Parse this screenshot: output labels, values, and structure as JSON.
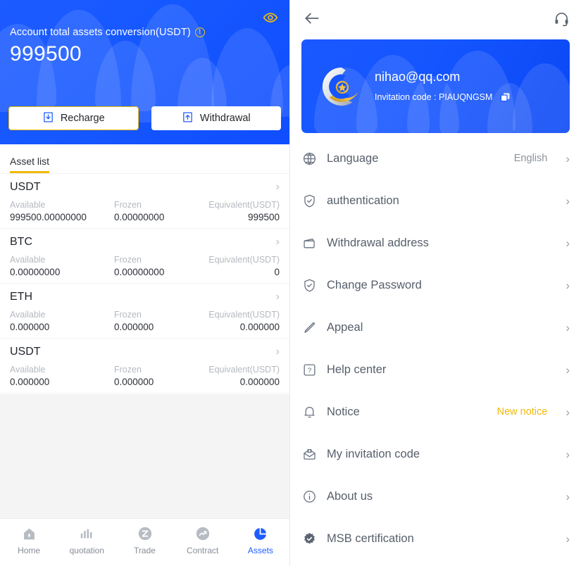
{
  "left": {
    "hero": {
      "eye_icon": "eye-icon",
      "label": "Account total assets conversion(USDT)",
      "info_icon": "info-icon",
      "amount": "999500",
      "recharge_label": "Recharge",
      "recharge_icon": "download-box-icon",
      "withdrawal_label": "Withdrawal",
      "withdrawal_icon": "upload-box-icon",
      "accent_border": "#f0b90b",
      "bg_color": "#1658ff"
    },
    "tabs": [
      {
        "label": "Asset list",
        "active": true
      }
    ],
    "columns": {
      "available": "Available",
      "frozen": "Frozen",
      "equivalent": "Equivalent(USDT)"
    },
    "assets": [
      {
        "name": "USDT",
        "available": "999500.00000000",
        "frozen": "0.00000000",
        "equivalent": "999500"
      },
      {
        "name": "BTC",
        "available": "0.00000000",
        "frozen": "0.00000000",
        "equivalent": "0"
      },
      {
        "name": "ETH",
        "available": "0.000000",
        "frozen": "0.000000",
        "equivalent": "0.000000"
      },
      {
        "name": "USDT",
        "available": "0.000000",
        "frozen": "0.000000",
        "equivalent": "0.000000"
      }
    ],
    "bottom_nav": [
      {
        "label": "Home",
        "icon": "home-icon",
        "active": false
      },
      {
        "label": "quotation",
        "icon": "bars-icon",
        "active": false
      },
      {
        "label": "Trade",
        "icon": "trade-icon",
        "active": false
      },
      {
        "label": "Contract",
        "icon": "contract-icon",
        "active": false
      },
      {
        "label": "Assets",
        "icon": "pie-chart-icon",
        "active": true
      }
    ],
    "nav_active_color": "#1e5cff"
  },
  "right": {
    "topbar": {
      "back_icon": "back-arrow-icon",
      "support_icon": "headset-icon"
    },
    "profile": {
      "avatar_icon": "spiral-star-logo-icon",
      "email": "nihao@qq.com",
      "invite_label": "Invitation code : PIAUQNGSM",
      "copy_icon": "copy-icon",
      "bg_color": "#1455ff"
    },
    "menu": [
      {
        "icon": "globe-icon",
        "label": "Language",
        "value": "English",
        "value_style": "normal"
      },
      {
        "icon": "shield-check-icon",
        "label": "authentication",
        "value": "",
        "value_style": "normal"
      },
      {
        "icon": "wallet-icon",
        "label": "Withdrawal address",
        "value": "",
        "value_style": "normal"
      },
      {
        "icon": "shield-check-icon",
        "label": "Change Password",
        "value": "",
        "value_style": "normal"
      },
      {
        "icon": "pen-icon",
        "label": "Appeal",
        "value": "",
        "value_style": "normal"
      },
      {
        "icon": "question-box-icon",
        "label": "Help center",
        "value": "",
        "value_style": "normal"
      },
      {
        "icon": "bell-icon",
        "label": "Notice",
        "value": "New notice",
        "value_style": "warn"
      },
      {
        "icon": "invite-mail-icon",
        "label": "My invitation code",
        "value": "",
        "value_style": "normal"
      },
      {
        "icon": "info-icon",
        "label": "About us",
        "value": "",
        "value_style": "normal"
      },
      {
        "icon": "badge-check-icon",
        "label": "MSB certification",
        "value": "",
        "value_style": "normal"
      }
    ],
    "chevron": "›",
    "warn_color": "#f0b90b"
  }
}
